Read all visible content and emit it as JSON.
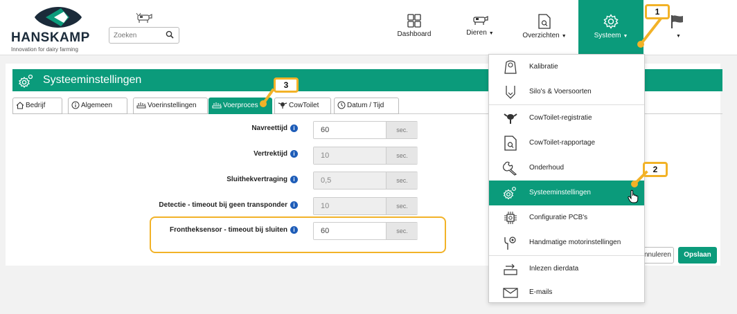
{
  "brand": {
    "name": "HANSKAMP",
    "tagline": "Innovation for dairy farming"
  },
  "search": {
    "placeholder": "Zoeken"
  },
  "nav": [
    {
      "label": "Dashboard",
      "icon": "dashboard-icon",
      "caret": ""
    },
    {
      "label": "Dieren",
      "icon": "cow-icon",
      "caret": "▼"
    },
    {
      "label": "Overzichten",
      "icon": "report-icon",
      "caret": "▼"
    },
    {
      "label": "Systeem",
      "icon": "gear-icon",
      "caret": "▼"
    },
    {
      "label": "",
      "icon": "flag-icon",
      "caret": "▼"
    }
  ],
  "page": {
    "title": "Systeeminstellingen"
  },
  "tabs": [
    {
      "label": "Bedrijf",
      "icon": "home-icon"
    },
    {
      "label": "Algemeen",
      "icon": "info-circle-icon"
    },
    {
      "label": "Voerinstellingen",
      "icon": "feed-icon"
    },
    {
      "label": "Voerproces",
      "icon": "feed-icon",
      "active": true
    },
    {
      "label": "CowToilet",
      "icon": "cow-icon"
    },
    {
      "label": "Datum / Tijd",
      "icon": "clock-icon"
    }
  ],
  "settings": [
    {
      "label": "Navreettijd",
      "value": "60",
      "unit": "sec.",
      "readonly": false
    },
    {
      "label": "Vertrektijd",
      "value": "10",
      "unit": "sec.",
      "readonly": true
    },
    {
      "label": "Sluithekvertraging",
      "value": "0,5",
      "unit": "sec.",
      "readonly": true
    },
    {
      "label": "Detectie - timeout bij geen transponder",
      "value": "10",
      "unit": "sec.",
      "readonly": true
    },
    {
      "label": "Frontheksensor - timeout bij sluiten",
      "value": "60",
      "unit": "sec.",
      "readonly": false
    }
  ],
  "buttons": {
    "cancel": "nnuleren",
    "save": "Opslaan"
  },
  "menu": [
    {
      "label": "Kalibratie",
      "icon": "scale-icon"
    },
    {
      "label": "Silo's & Voersoorten",
      "icon": "silo-icon"
    },
    {
      "label": "CowToilet-registratie",
      "icon": "cow-icon"
    },
    {
      "label": "CowToilet-rapportage",
      "icon": "report-icon"
    },
    {
      "label": "Onderhoud",
      "icon": "wrench-icon"
    },
    {
      "label": "Systeeminstellingen",
      "icon": "gear-icon",
      "active": true
    },
    {
      "label": "Configuratie PCB's",
      "icon": "chip-icon"
    },
    {
      "label": "Handmatige motorinstellingen",
      "icon": "motor-icon"
    },
    {
      "label": "Inlezen dierdata",
      "icon": "import-icon"
    },
    {
      "label": "E-mails",
      "icon": "mail-icon"
    }
  ],
  "annotations": [
    "1",
    "2",
    "3"
  ],
  "colors": {
    "brand_green": "#0b9b7b",
    "highlight": "#f2b227",
    "info_blue": "#1e5db8"
  }
}
